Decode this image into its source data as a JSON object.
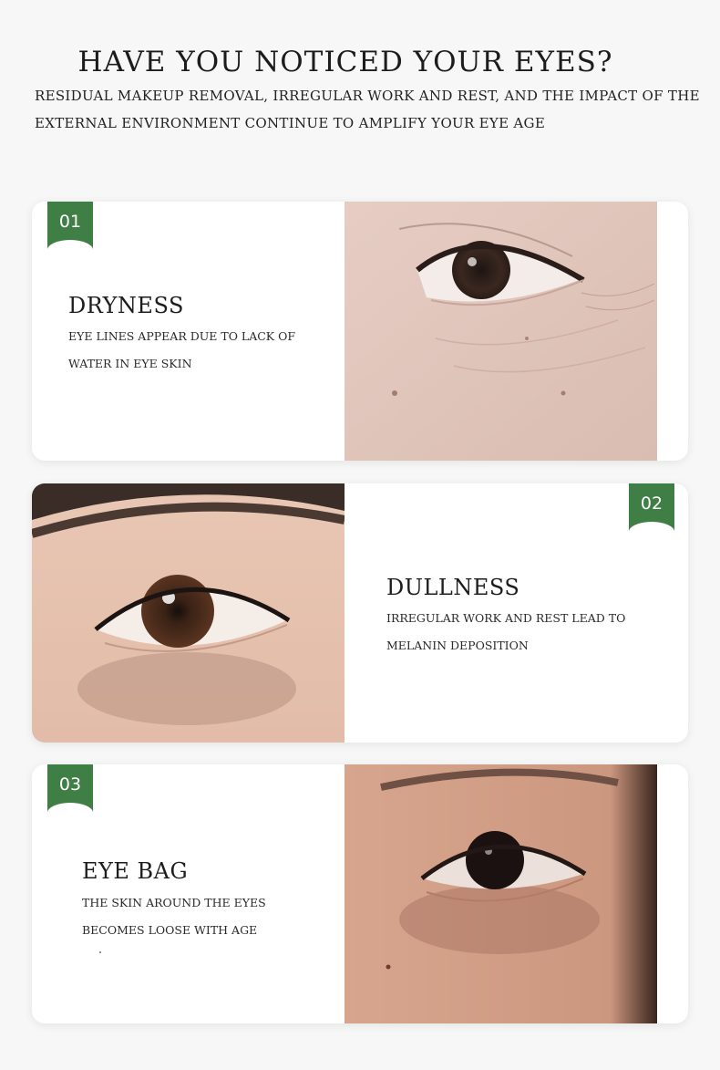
{
  "header": {
    "title": "HAVE YOU NOTICED YOUR EYES?",
    "subtitle": "RESIDUAL MAKEUP REMOVAL, IRREGULAR WORK AND REST, AND THE IMPACT OF THE EXTERNAL ENVIRONMENT CONTINUE TO AMPLIFY YOUR EYE AGE"
  },
  "colors": {
    "accent": "#3f7f45",
    "background": "#f6f7f6",
    "card": "#ffffff"
  },
  "cards": [
    {
      "number": "01",
      "heading": "DRYNESS",
      "description": "EYE LINES APPEAR DUE TO LACK OF WATER IN EYE SKIN",
      "photo": "wrinkled-eye-photo"
    },
    {
      "number": "02",
      "heading": "DULLNESS",
      "description": "IRREGULAR WORK AND REST LEAD TO MELANIN DEPOSITION",
      "photo": "dark-circle-eye-photo"
    },
    {
      "number": "03",
      "heading": "EYE BAG",
      "description": "THE SKIN AROUND THE EYES BECOMES LOOSE WITH AGE",
      "photo": "eye-bag-photo"
    }
  ]
}
